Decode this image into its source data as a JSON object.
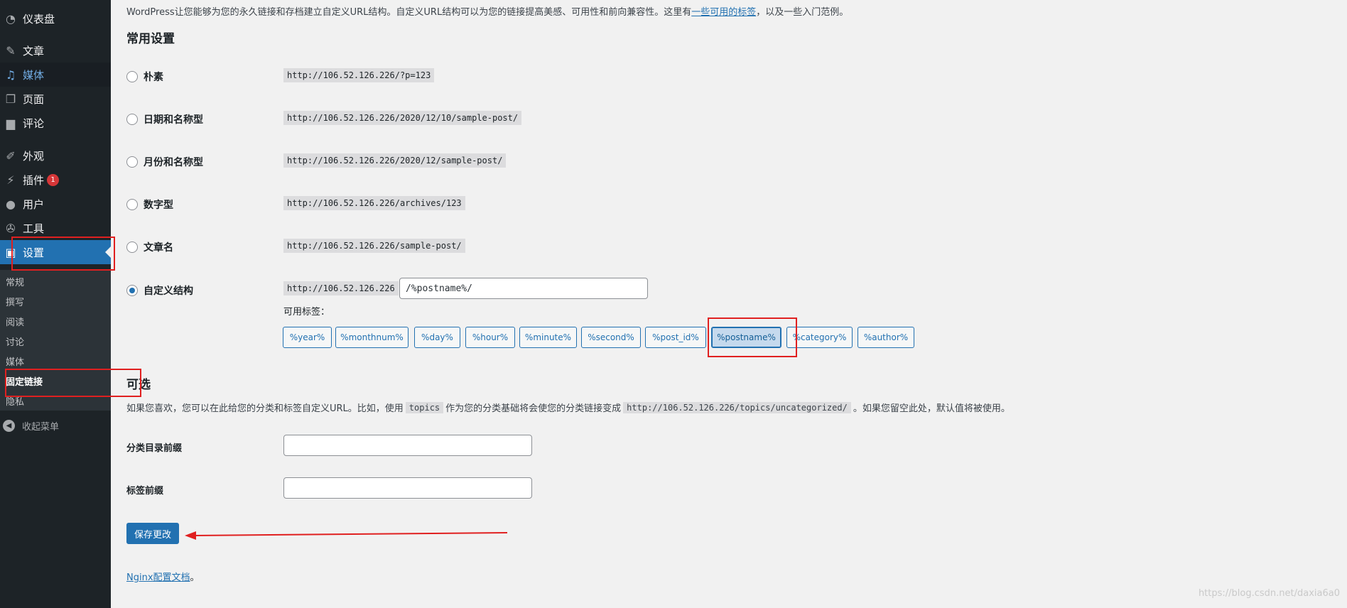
{
  "sidebar": {
    "items": [
      {
        "label": "仪表盘",
        "icon": "dashboard-icon"
      },
      {
        "label": "文章",
        "icon": "pin-icon"
      },
      {
        "label": "媒体",
        "icon": "media-icon"
      },
      {
        "label": "页面",
        "icon": "page-icon"
      },
      {
        "label": "评论",
        "icon": "comment-icon"
      },
      {
        "label": "外观",
        "icon": "brush-icon"
      },
      {
        "label": "插件",
        "icon": "plugin-icon",
        "badge": "1"
      },
      {
        "label": "用户",
        "icon": "user-icon"
      },
      {
        "label": "工具",
        "icon": "wrench-icon"
      },
      {
        "label": "设置",
        "icon": "settings-icon"
      }
    ],
    "submenu": [
      "常规",
      "撰写",
      "阅读",
      "讨论",
      "媒体",
      "固定链接",
      "隐私"
    ],
    "collapse_label": "收起菜单"
  },
  "intro": {
    "before": "WordPress让您能够为您的永久链接和存档建立自定义URL结构。自定义URL结构可以为您的链接提高美感、可用性和前向兼容性。这里有",
    "link": "一些可用的标签",
    "after": "，以及一些入门范例。"
  },
  "common": {
    "title": "常用设置",
    "options": [
      {
        "label": "朴素",
        "example": "http://106.52.126.226/?p=123"
      },
      {
        "label": "日期和名称型",
        "example": "http://106.52.126.226/2020/12/10/sample-post/"
      },
      {
        "label": "月份和名称型",
        "example": "http://106.52.126.226/2020/12/sample-post/"
      },
      {
        "label": "数字型",
        "example": "http://106.52.126.226/archives/123"
      },
      {
        "label": "文章名",
        "example": "http://106.52.126.226/sample-post/"
      },
      {
        "label": "自定义结构",
        "example": "http://106.52.126.226"
      }
    ],
    "custom_value": "/%postname%/",
    "available_label": "可用标签：",
    "tags": [
      "%year%",
      "%monthnum%",
      "%day%",
      "%hour%",
      "%minute%",
      "%second%",
      "%post_id%",
      "%postname%",
      "%category%",
      "%author%"
    ]
  },
  "optional": {
    "title": "可选",
    "desc_before": "如果您喜欢，您可以在此给您的分类和标签自定义URL。比如，使用",
    "desc_code1": "topics",
    "desc_middle": "作为您的分类基础将会使您的分类链接变成",
    "desc_code2": "http://106.52.126.226/topics/uncategorized/",
    "desc_after": "。如果您留空此处，默认值将被使用。",
    "category_label": "分类目录前缀",
    "tag_label": "标签前缀"
  },
  "save_label": "保存更改",
  "nginx": {
    "link": "Nginx配置文档",
    "after": "。"
  },
  "watermark": "https://blog.csdn.net/daxia6a0"
}
